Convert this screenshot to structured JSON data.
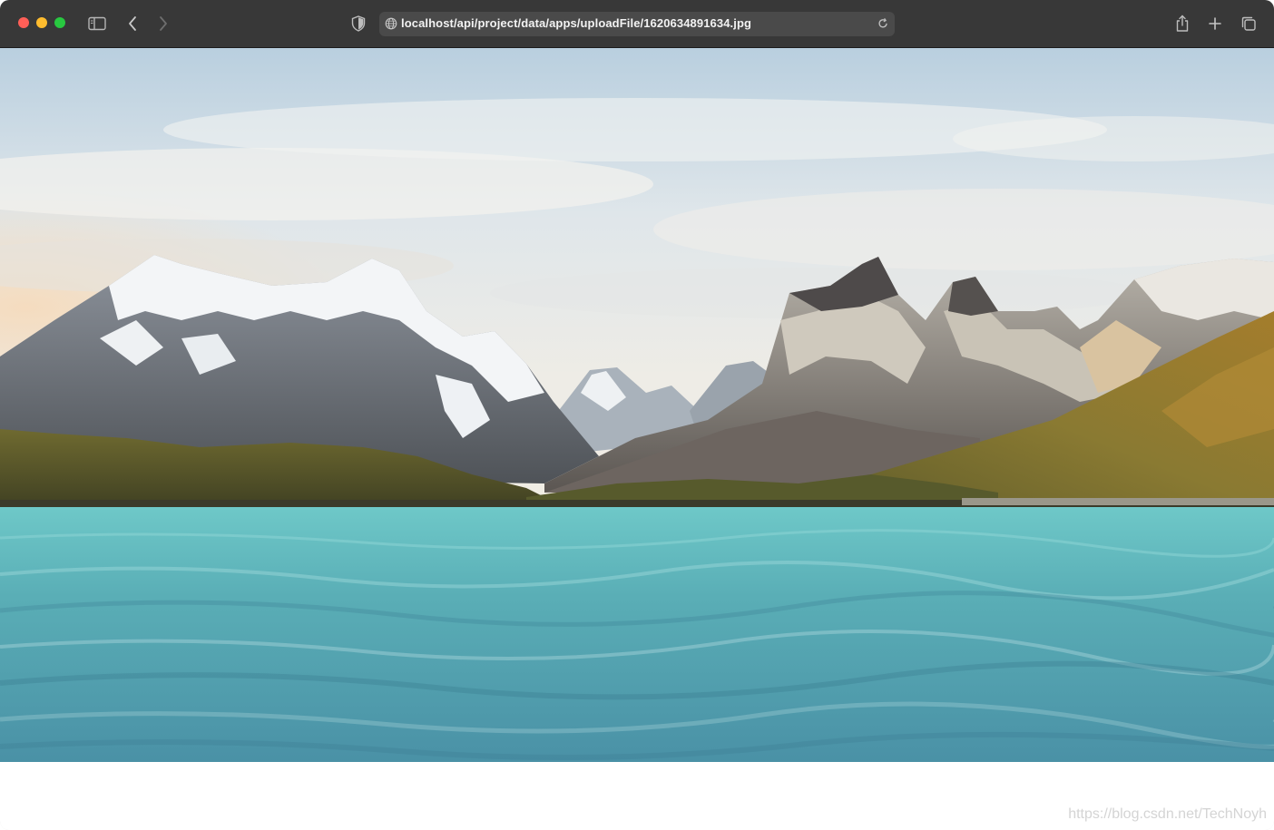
{
  "browser": {
    "url": "localhost/api/project/data/apps/uploadFile/1620634891634.jpg",
    "icons": {
      "sidebar": "sidebar-toggle-icon",
      "back": "chevron-left-icon",
      "forward": "chevron-right-icon",
      "privacy": "shield-icon",
      "site": "globe-icon",
      "reload": "reload-icon",
      "share": "share-icon",
      "new_tab": "plus-icon",
      "tabs": "tab-overview-icon"
    },
    "colors": {
      "toolbar": "#383838",
      "address_bar": "#4a4a4a",
      "close": "#ff5f57",
      "minimize": "#febc2e",
      "maximize": "#28c840"
    }
  },
  "page": {
    "image_subject": "mountain-lake-landscape",
    "watermark": "https://blog.csdn.net/TechNoyh"
  }
}
